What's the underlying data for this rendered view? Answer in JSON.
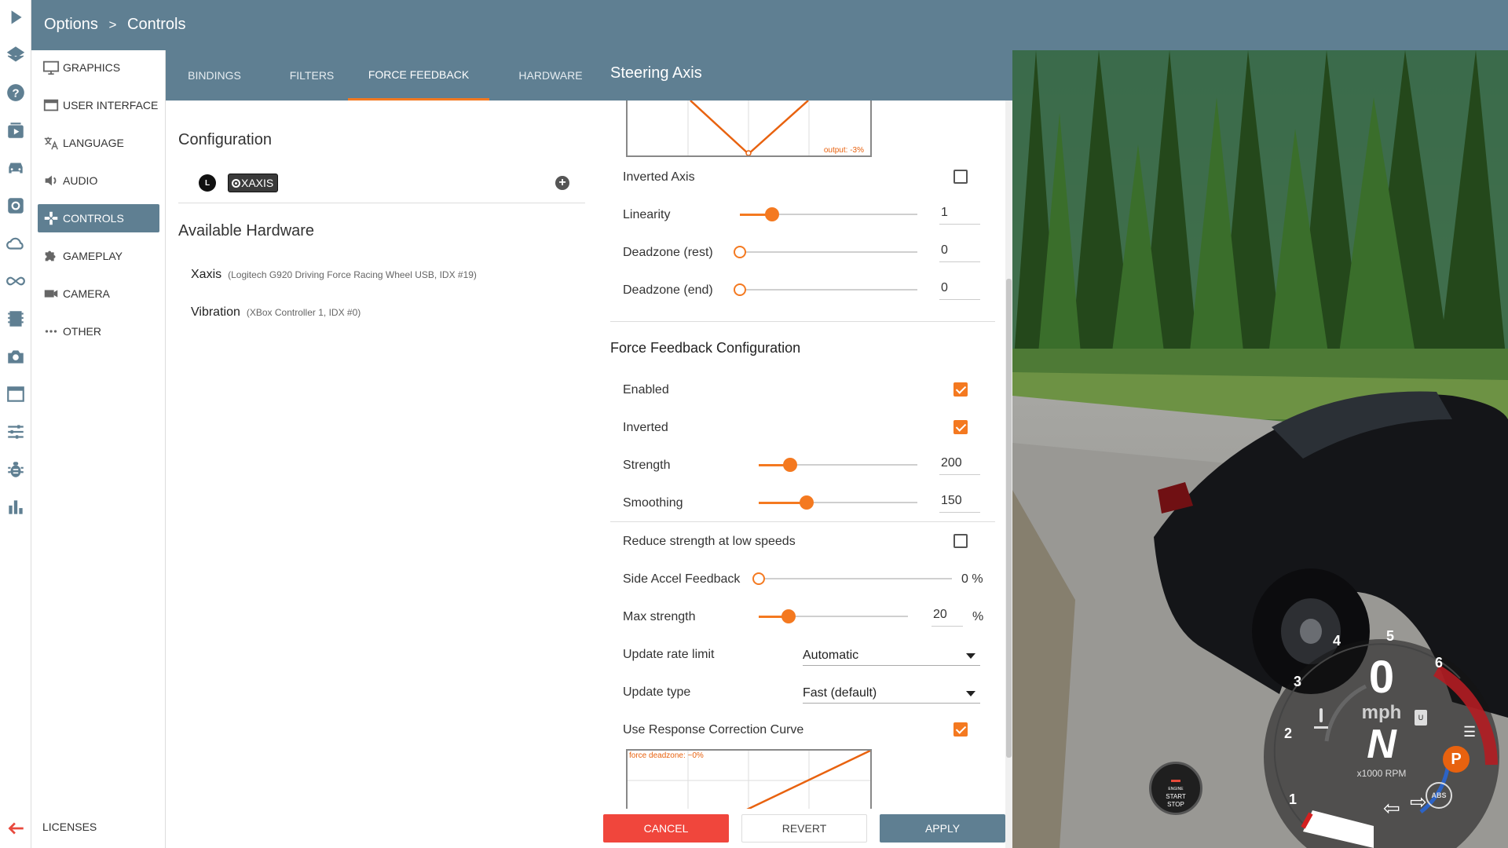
{
  "breadcrumb": {
    "root": "Options",
    "sep": ">",
    "current": "Controls"
  },
  "rail_icons": [
    "play-icon",
    "layers-icon",
    "help-icon",
    "video-play-icon",
    "car-icon",
    "settings-icon",
    "cloud-icon",
    "infinity-icon",
    "film-icon",
    "camera-icon",
    "window-icon",
    "sliders-icon",
    "bug-icon",
    "bar-chart-icon",
    "back-arrow-icon"
  ],
  "categories": [
    {
      "label": "GRAPHICS",
      "icon": "monitor-icon"
    },
    {
      "label": "USER INTERFACE",
      "icon": "window-icon"
    },
    {
      "label": "LANGUAGE",
      "icon": "translate-icon"
    },
    {
      "label": "AUDIO",
      "icon": "speaker-icon"
    },
    {
      "label": "CONTROLS",
      "icon": "gamepad-icon",
      "active": true
    },
    {
      "label": "GAMEPLAY",
      "icon": "puzzle-icon"
    },
    {
      "label": "CAMERA",
      "icon": "videocam-icon"
    },
    {
      "label": "OTHER",
      "icon": "more-icon"
    }
  ],
  "licenses": "LICENSES",
  "tabs": [
    {
      "label": "BINDINGS"
    },
    {
      "label": "FILTERS"
    },
    {
      "label": "FORCE FEEDBACK",
      "active": true
    },
    {
      "label": "HARDWARE"
    }
  ],
  "panel_title": "Steering Axis",
  "configuration": {
    "title": "Configuration",
    "device_badge": "L",
    "binding": "XAXIS"
  },
  "available_hardware": {
    "title": "Available Hardware",
    "items": [
      {
        "name": "Xaxis",
        "desc": "(Logitech G920 Driving Force Racing Wheel USB, IDX #19)"
      },
      {
        "name": "Vibration",
        "desc": "(XBox Controller 1, IDX #0)"
      }
    ]
  },
  "axis": {
    "graph_label": "output: -3%",
    "inverted_label": "Inverted Axis",
    "inverted": false,
    "linearity": {
      "label": "Linearity",
      "value": "1",
      "fraction": 0.18
    },
    "deadzone_rest": {
      "label": "Deadzone (rest)",
      "value": "0",
      "fraction": 0
    },
    "deadzone_end": {
      "label": "Deadzone (end)",
      "value": "0",
      "fraction": 0
    }
  },
  "ffb": {
    "title": "Force Feedback Configuration",
    "enabled_label": "Enabled",
    "enabled": true,
    "inverted_label": "Inverted",
    "inverted": true,
    "strength": {
      "label": "Strength",
      "value": "200",
      "fraction": 0.2
    },
    "smoothing": {
      "label": "Smoothing",
      "value": "150",
      "fraction": 0.3
    },
    "reduce_label": "Reduce strength at low speeds",
    "reduce": false,
    "side_accel": {
      "label": "Side Accel Feedback",
      "value": "0",
      "unit": "%",
      "fraction": 0
    },
    "max_strength": {
      "label": "Max strength",
      "value": "20",
      "unit": "%",
      "fraction": 0.2
    },
    "update_rate": {
      "label": "Update rate limit",
      "value": "Automatic"
    },
    "update_type": {
      "label": "Update type",
      "value": "Fast (default)"
    },
    "response_curve_label": "Use Response Correction Curve",
    "response_curve": true,
    "curve_label": "force deadzone: ~0%"
  },
  "buttons": {
    "cancel": "CANCEL",
    "revert": "REVERT",
    "apply": "APPLY"
  },
  "hud": {
    "speed": "0",
    "speed_unit": "mph",
    "gear": "N",
    "rpm_label": "x1000 RPM",
    "ticks": [
      "1",
      "2",
      "3",
      "4",
      "5",
      "6"
    ],
    "engine_btn": [
      "ENGINE",
      "START",
      "STOP"
    ],
    "parking": "P",
    "abs": "ABS",
    "fuel": "U"
  },
  "colors": {
    "accent": "#f47920",
    "header": "#5f7f92",
    "cancel": "#f0463c"
  }
}
